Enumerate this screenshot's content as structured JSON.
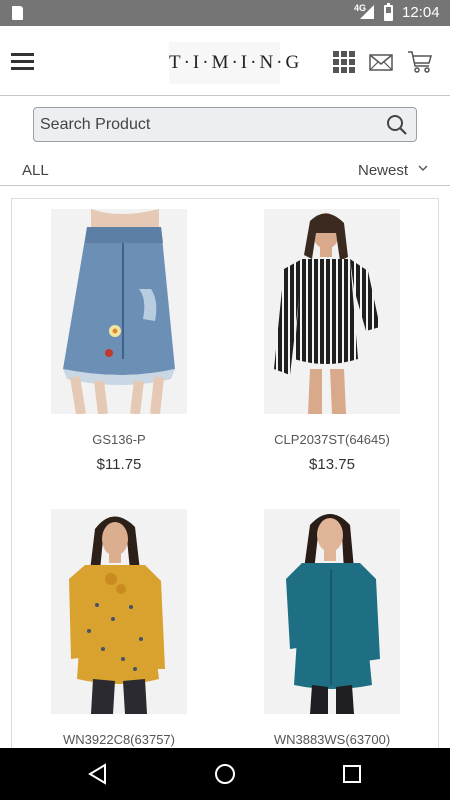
{
  "status_bar": {
    "network": "4G",
    "time": "12:04"
  },
  "header": {
    "logo_text": "T·I·M·I·N·G"
  },
  "search": {
    "placeholder": "Search Product",
    "value": ""
  },
  "filter": {
    "category": "ALL",
    "sort_label": "Newest"
  },
  "products": [
    {
      "name": "GS136-P",
      "price": "$11.75",
      "image": "denim-skirt"
    },
    {
      "name": "CLP2037ST(64645)",
      "price": "$13.75",
      "image": "striped-romper"
    },
    {
      "name": "WN3922C8(63757)",
      "price": "",
      "image": "mustard-blouse"
    },
    {
      "name": "WN3883WS(63700)",
      "price": "",
      "image": "teal-tunic"
    }
  ],
  "icons": {
    "menu": "hamburger-icon",
    "grid": "grid-icon",
    "mail": "mail-icon",
    "cart": "cart-icon",
    "search": "search-icon",
    "sort": "chevron-down-icon",
    "nav": [
      "back-icon",
      "home-icon",
      "recents-icon"
    ]
  },
  "colors": {
    "status_bar": "#757575",
    "nav_bar": "#000000",
    "teal": "#1e6f84",
    "mustard": "#d9a22f"
  }
}
